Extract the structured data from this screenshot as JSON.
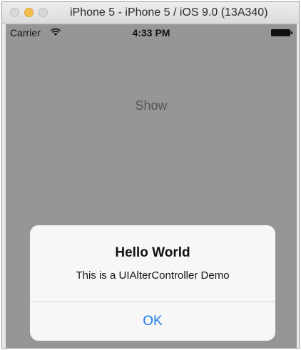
{
  "window": {
    "title": "iPhone 5 - iPhone 5 / iOS 9.0 (13A340)"
  },
  "status_bar": {
    "carrier": "Carrier",
    "time": "4:33 PM",
    "wifi_icon": "wifi-icon",
    "battery_icon": "battery-icon"
  },
  "main": {
    "show_label": "Show"
  },
  "alert": {
    "title": "Hello World",
    "message": "This is a UIAlterController Demo",
    "ok_label": "OK"
  },
  "colors": {
    "accent": "#1e7cf2",
    "dimmed_background": "#969696",
    "alert_background": "#f7f7f7"
  }
}
